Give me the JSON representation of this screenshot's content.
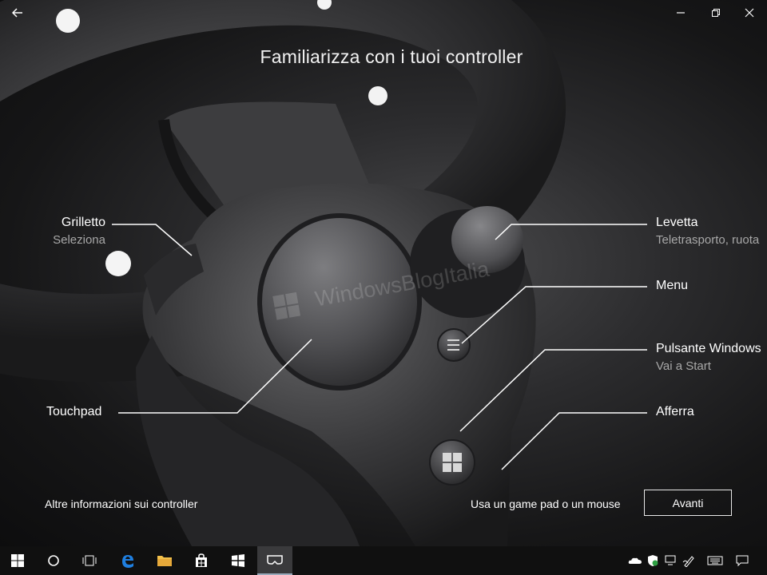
{
  "window": {
    "title": "Familiarizza con i tuoi controller",
    "back_icon": "back-arrow-icon",
    "minimize_icon": "minimize-icon",
    "restore_icon": "restore-icon",
    "close_icon": "close-icon"
  },
  "callouts": {
    "grilletto": {
      "label": "Grilletto",
      "sub": "Seleziona"
    },
    "touchpad": {
      "label": "Touchpad"
    },
    "levetta": {
      "label": "Levetta",
      "sub": "Teletrasporto, ruota"
    },
    "menu": {
      "label": "Menu"
    },
    "windows": {
      "label": "Pulsante Windows",
      "sub": "Vai a Start"
    },
    "afferra": {
      "label": "Afferra"
    }
  },
  "watermark": "WindowsBlogItalia",
  "footer": {
    "more_info_link": "Altre informazioni sui controller",
    "alt_input_link": "Usa un game pad o un mouse",
    "next_button": "Avanti"
  },
  "taskbar": {
    "items": [
      "start-icon",
      "cortana-icon",
      "task-view-icon",
      "edge-icon",
      "file-explorer-icon",
      "store-icon",
      "app-icon",
      "mixed-reality-portal-icon"
    ],
    "tray": [
      "onedrive-icon",
      "defender-icon",
      "network-icon",
      "pen-icon",
      "keyboard-icon",
      "notifications-icon"
    ]
  },
  "colors": {
    "background": "#1a1a1b",
    "callout_line": "#ffffff",
    "sub_text": "#a8a8a8",
    "taskbar": "#101010"
  }
}
